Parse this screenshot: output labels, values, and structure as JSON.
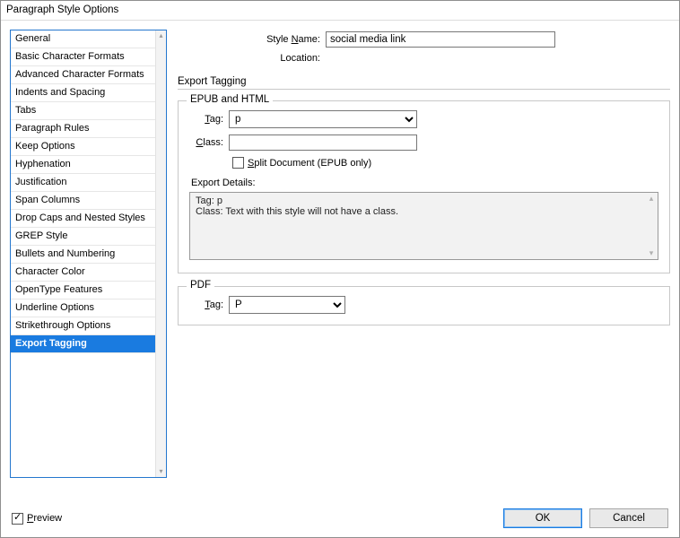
{
  "titlebar": "Paragraph Style Options",
  "sidebar": {
    "items": [
      "General",
      "Basic Character Formats",
      "Advanced Character Formats",
      "Indents and Spacing",
      "Tabs",
      "Paragraph Rules",
      "Keep Options",
      "Hyphenation",
      "Justification",
      "Span Columns",
      "Drop Caps and Nested Styles",
      "GREP Style",
      "Bullets and Numbering",
      "Character Color",
      "OpenType Features",
      "Underline Options",
      "Strikethrough Options",
      "Export Tagging"
    ],
    "selected_index": 17
  },
  "header": {
    "style_name_label": "Style Name:",
    "style_name_value": "social media link",
    "location_label": "Location:",
    "location_value": ""
  },
  "section_title": "Export Tagging",
  "epub": {
    "legend": "EPUB and HTML",
    "tag_label": "Tag:",
    "tag_value": "p",
    "class_label": "Class:",
    "class_value": "",
    "split_label": "Split Document (EPUB only)",
    "split_checked": false,
    "details_label": "Export Details:",
    "details_line1": "Tag: p",
    "details_line2": "Class: Text with this style will not have a class."
  },
  "pdf": {
    "legend": "PDF",
    "tag_label": "Tag:",
    "tag_value": "P"
  },
  "footer": {
    "preview_label": "Preview",
    "preview_checked": true,
    "ok": "OK",
    "cancel": "Cancel"
  }
}
